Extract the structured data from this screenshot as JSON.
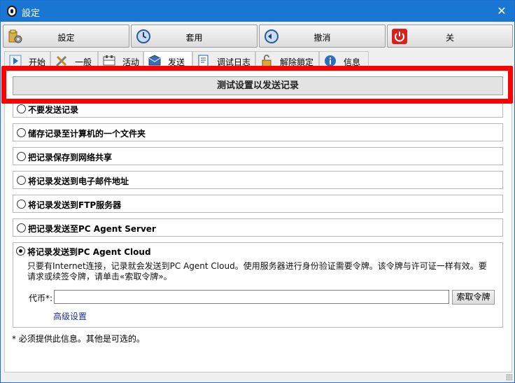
{
  "window": {
    "title": "設定",
    "close_glyph": "✕"
  },
  "toolbar": {
    "buttons": [
      {
        "label": "設定",
        "icon": "settings-folder-icon"
      },
      {
        "label": "套用",
        "icon": "apply-clock-icon"
      },
      {
        "label": "撤消",
        "icon": "undo-clock-icon"
      },
      {
        "label": "关",
        "icon": "power-icon"
      }
    ]
  },
  "tabs": [
    {
      "label": "开始",
      "icon": "start-icon"
    },
    {
      "label": "一般",
      "icon": "tools-icon"
    },
    {
      "label": "活动",
      "icon": "activity-icon"
    },
    {
      "label": "发送",
      "icon": "send-icon",
      "active": true
    },
    {
      "label": "调试日志",
      "icon": "log-icon"
    },
    {
      "label": "解除鎖定",
      "icon": "unlock-icon"
    },
    {
      "label": "信息",
      "icon": "info-icon"
    }
  ],
  "send": {
    "test_button": "测试设置以发送记录",
    "options": [
      "不要发送记录",
      "储存记录至计算机的一个文件夹",
      "把记录保存到网络共享",
      "将记录发送到电子邮件地址",
      "将记录发送到FTP服务器",
      "把记录发送至PC Agent Server",
      "将记录发送到PC Agent Cloud"
    ],
    "selected_option": 6,
    "cloud_description": "只要有Internet连接，记录就会发送到PC Agent Cloud。使用服务器进行身份验证需要令牌。该令牌与许可证一样有效。要请求或续签令牌，请单击«索取令牌»。",
    "token_label": "代币*:",
    "token_value": "",
    "token_button": "索取令牌",
    "advanced_link": "高级设置",
    "footnote": "* 必须提供此信息。其他是可选的。"
  },
  "colors": {
    "titlebar": "#1976d2",
    "highlight": "#ff0000",
    "link": "#1a2e9e"
  }
}
